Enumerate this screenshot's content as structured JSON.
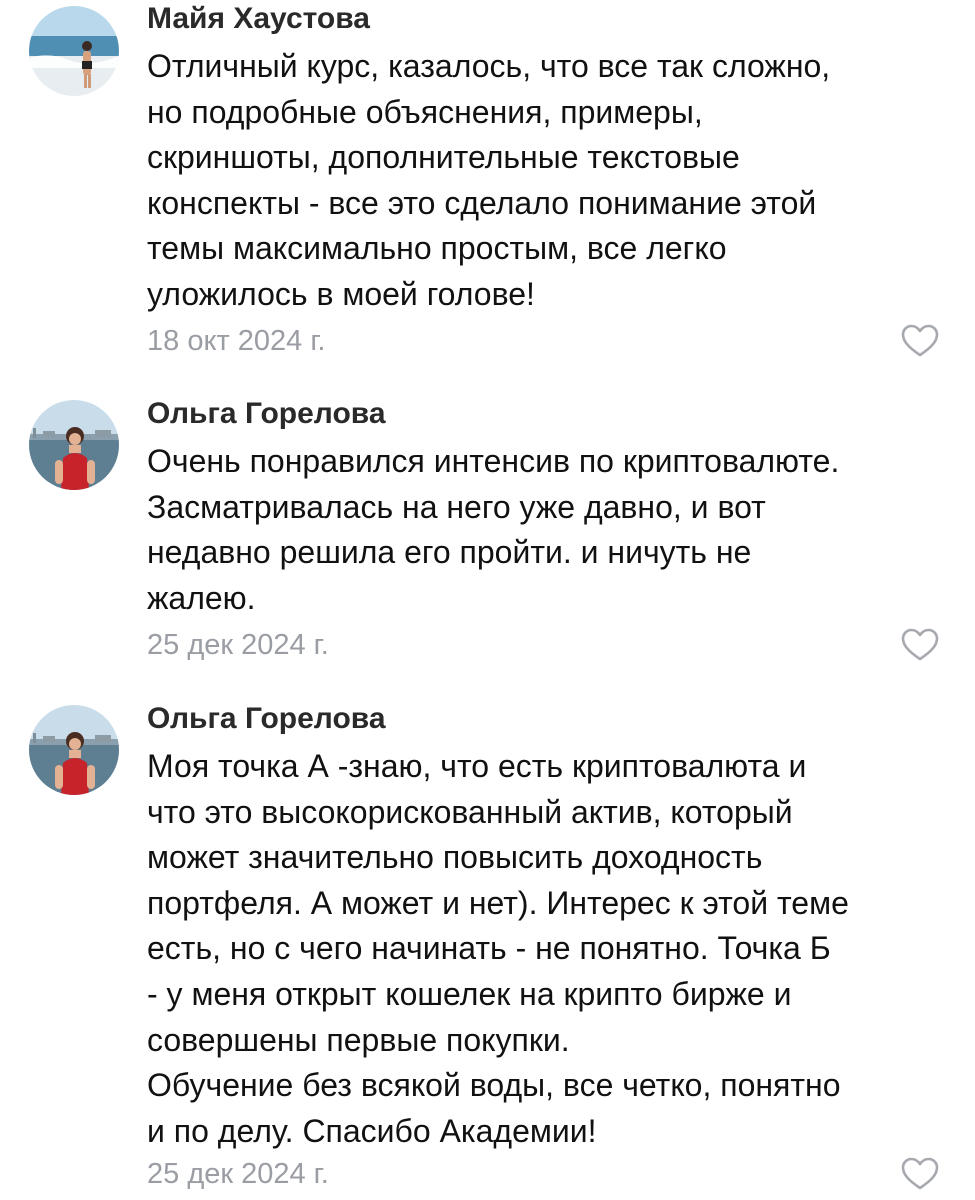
{
  "comments": [
    {
      "author": "Майя Хаустова",
      "lines": [
        "Отличный курс, казалось, что все так сложно,",
        "но подробные объяснения, примеры,",
        "скриншоты, дополнительные текстовые",
        "конспекты - все это сделало понимание этой",
        "темы максимально простым, все легко",
        "уложилось в моей голове!"
      ],
      "date": "18 окт 2024 г.",
      "avatar_icon": "beach-photo-avatar",
      "like_icon": "heart-outline-icon"
    },
    {
      "author": "Ольга Горелова",
      "lines": [
        "Очень понравился интенсив по криптовалюте.",
        "Засматривалась на него уже давно, и вот",
        "недавно решила его пройти. и ничуть не",
        "жалею."
      ],
      "date": "25 дек 2024 г.",
      "avatar_icon": "city-photo-avatar",
      "like_icon": "heart-outline-icon"
    },
    {
      "author": "Ольга Горелова",
      "lines": [
        "Моя точка А -знаю, что есть криптовалюта и",
        "что это высокорискованный актив, который",
        "может значительно повысить доходность",
        "портфеля. А может и нет). Интерес к этой теме",
        "есть, но с чего начинать - не понятно. Точка Б",
        "- у меня открыт кошелек на крипто бирже и",
        "совершены первые покупки.",
        "Обучение без всякой воды, все четко, понятно",
        "и по делу. Спасибо Академии!"
      ],
      "date": "25 дек 2024 г.",
      "avatar_icon": "city-photo-avatar",
      "like_icon": "heart-outline-icon"
    }
  ],
  "colors": {
    "text": "#111111",
    "author": "#2a2a2a",
    "date": "#9a9da3",
    "like_icon": "#a6a9ae"
  }
}
